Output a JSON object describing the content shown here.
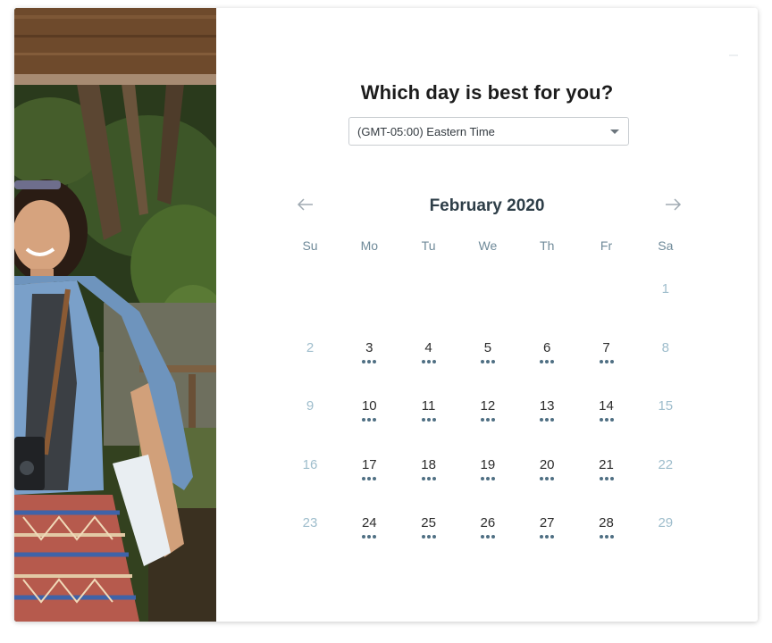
{
  "heading": "Which day is best for you?",
  "timezone": {
    "selected": "(GMT-05:00) Eastern Time"
  },
  "calendar": {
    "month_label": "February 2020",
    "prev_icon": "arrow-left-icon",
    "next_icon": "arrow-right-icon",
    "weekdays": [
      "Su",
      "Mo",
      "Tu",
      "We",
      "Th",
      "Fr",
      "Sa"
    ],
    "weeks": [
      [
        {
          "label": "",
          "available": false
        },
        {
          "label": "",
          "available": false
        },
        {
          "label": "",
          "available": false
        },
        {
          "label": "",
          "available": false
        },
        {
          "label": "",
          "available": false
        },
        {
          "label": "",
          "available": false
        },
        {
          "label": "1",
          "available": false
        }
      ],
      [
        {
          "label": "2",
          "available": false
        },
        {
          "label": "3",
          "available": true
        },
        {
          "label": "4",
          "available": true
        },
        {
          "label": "5",
          "available": true
        },
        {
          "label": "6",
          "available": true
        },
        {
          "label": "7",
          "available": true
        },
        {
          "label": "8",
          "available": false
        }
      ],
      [
        {
          "label": "9",
          "available": false
        },
        {
          "label": "10",
          "available": true
        },
        {
          "label": "11",
          "available": true
        },
        {
          "label": "12",
          "available": true
        },
        {
          "label": "13",
          "available": true
        },
        {
          "label": "14",
          "available": true
        },
        {
          "label": "15",
          "available": false
        }
      ],
      [
        {
          "label": "16",
          "available": false
        },
        {
          "label": "17",
          "available": true
        },
        {
          "label": "18",
          "available": true
        },
        {
          "label": "19",
          "available": true
        },
        {
          "label": "20",
          "available": true
        },
        {
          "label": "21",
          "available": true
        },
        {
          "label": "22",
          "available": false
        }
      ],
      [
        {
          "label": "23",
          "available": false
        },
        {
          "label": "24",
          "available": true
        },
        {
          "label": "25",
          "available": true
        },
        {
          "label": "26",
          "available": true
        },
        {
          "label": "27",
          "available": true
        },
        {
          "label": "28",
          "available": true
        },
        {
          "label": "29",
          "available": false
        }
      ]
    ]
  },
  "colors": {
    "text_dark": "#1c1c1c",
    "month_text": "#2e3e48",
    "weekday_text": "#6f8a99",
    "unavailable_day": "#9ebdcc",
    "availability_dots": "#4f6f83"
  }
}
